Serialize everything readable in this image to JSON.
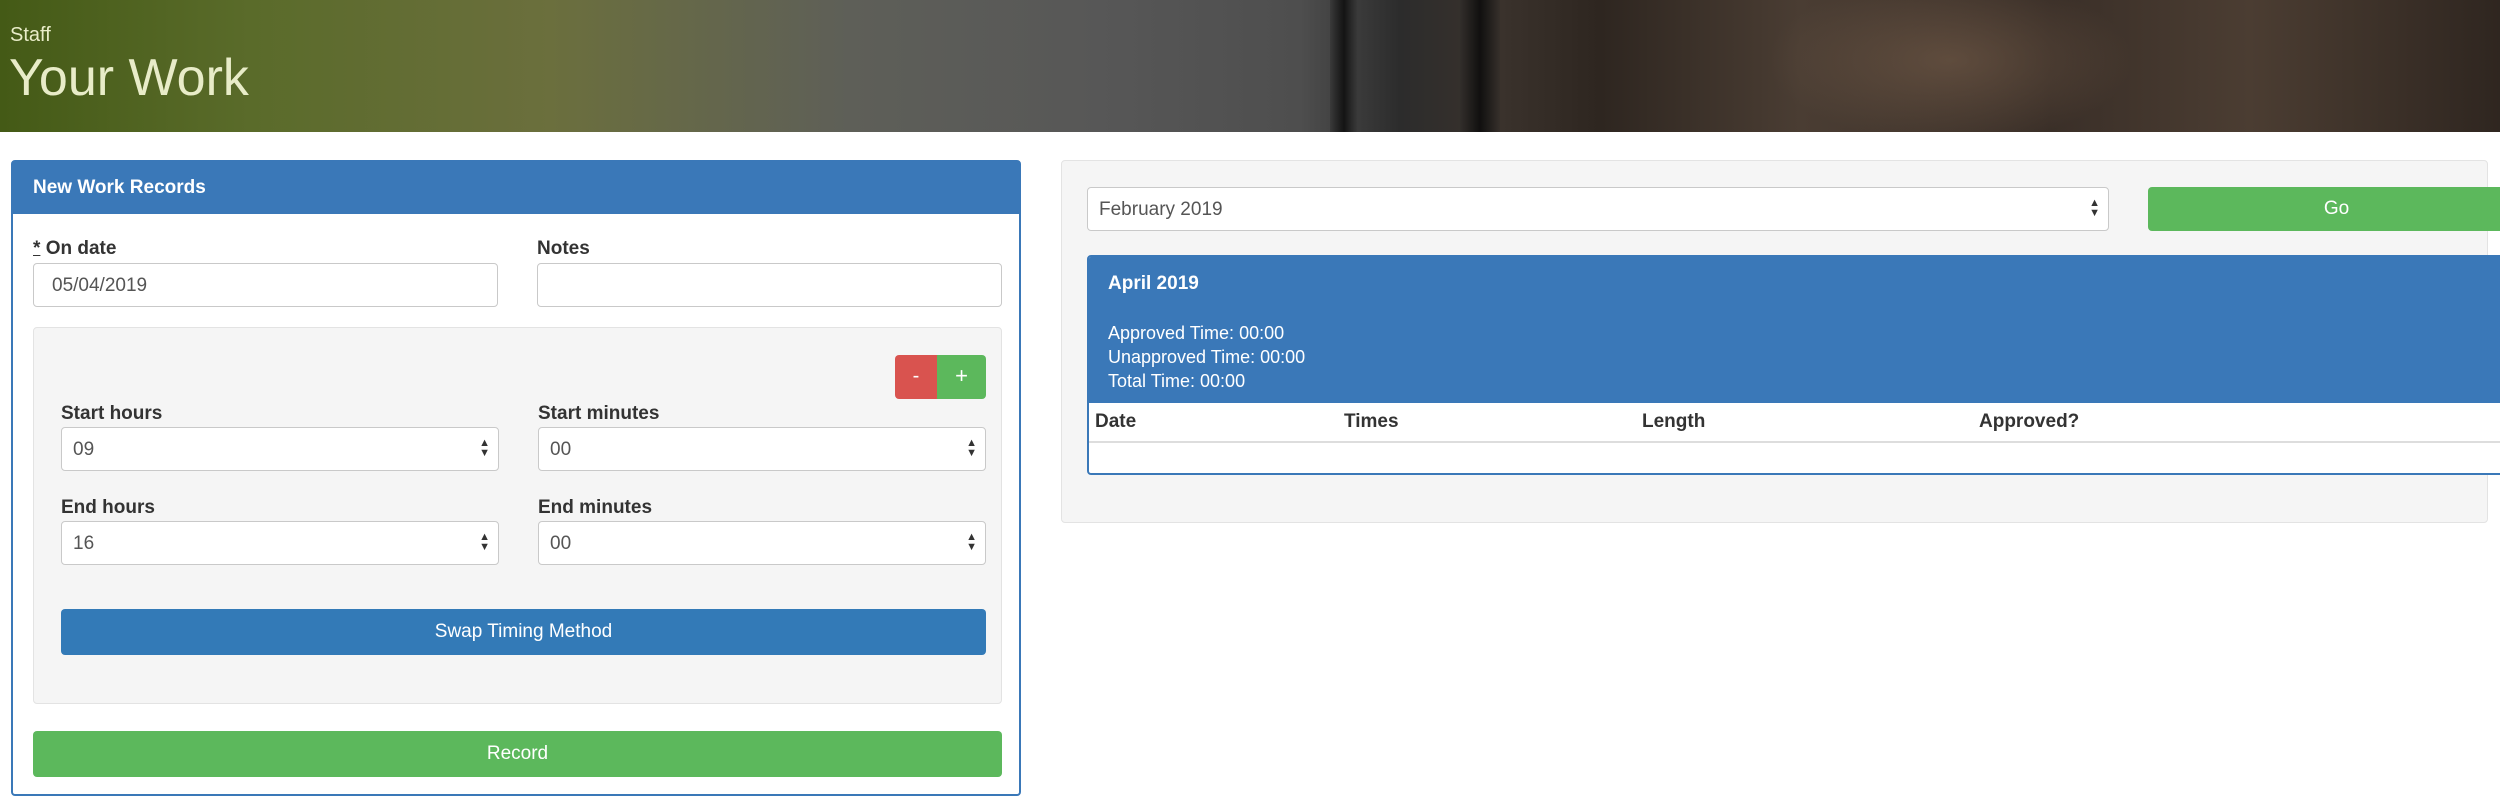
{
  "header": {
    "breadcrumb": "Staff",
    "title": "Your Work"
  },
  "new_records": {
    "panel_title": "New Work Records",
    "on_date": {
      "required_mark": "*",
      "label": "On date",
      "value": "05/04/2019"
    },
    "notes": {
      "label": "Notes",
      "value": ""
    },
    "remove_button": "-",
    "add_button": "+",
    "start_hours": {
      "label": "Start hours",
      "value": "09"
    },
    "start_minutes": {
      "label": "Start minutes",
      "value": "00"
    },
    "end_hours": {
      "label": "End hours",
      "value": "16"
    },
    "end_minutes": {
      "label": "End minutes",
      "value": "00"
    },
    "swap_button": "Swap Timing Method",
    "record_button": "Record"
  },
  "history": {
    "month_select": "February 2019",
    "go_button": "Go",
    "summary": {
      "month": "April 2019",
      "approved": "Approved Time: 00:00",
      "unapproved": "Unapproved Time: 00:00",
      "total": "Total Time: 00:00"
    },
    "columns": [
      "Date",
      "Times",
      "Length",
      "Approved?"
    ],
    "rows": []
  },
  "colors": {
    "primary": "#337ab7",
    "success": "#5cb85c",
    "danger": "#d9534f"
  }
}
